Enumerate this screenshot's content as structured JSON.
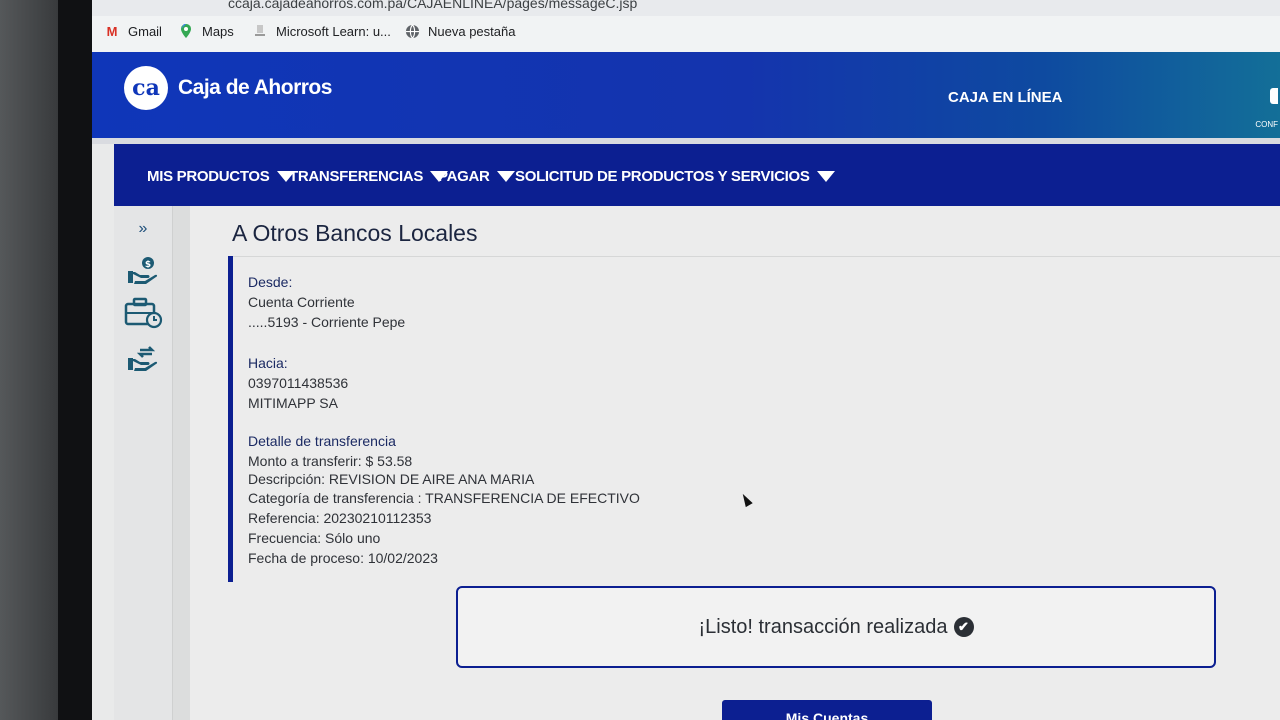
{
  "browser": {
    "url": "ccaja.cajadeahorros.com.pa/CAJAENLINEA/pages/messageC.jsp",
    "bookmarks": [
      {
        "label": "Gmail",
        "icon": "gmail-icon"
      },
      {
        "label": "Maps",
        "icon": "maps-icon"
      },
      {
        "label": "Microsoft Learn: u...",
        "icon": "microsoft-learn-icon"
      },
      {
        "label": "Nueva pestaña",
        "icon": "globe-icon"
      }
    ]
  },
  "header": {
    "logo_mark": "ca",
    "logo_text": "Caja de Ahorros",
    "online_label": "CAJA EN LÍNEA",
    "config_label": "CONF"
  },
  "nav": {
    "items": [
      {
        "label": "MIS PRODUCTOS"
      },
      {
        "label": "TRANSFERENCIAS"
      },
      {
        "label": "PAGAR"
      },
      {
        "label": "SOLICITUD DE PRODUCTOS Y SERVICIOS"
      }
    ]
  },
  "sidebar": {
    "collapse": "»",
    "icons": [
      "hand-money-icon",
      "briefcase-clock-icon",
      "hand-transfer-icon"
    ]
  },
  "page": {
    "title": "A Otros Bancos Locales"
  },
  "transfer": {
    "from_label": "Desde:",
    "from_type": "Cuenta Corriente",
    "from_account": ".....5193 - Corriente Pepe",
    "to_label": "Hacia:",
    "to_account": "0397011438536",
    "to_name": "MITIMAPP SA",
    "detail_label": "Detalle de transferencia",
    "amount": "Monto a transferir: $ 53.58",
    "description": "Descripción: REVISION DE AIRE ANA MARIA",
    "category": "Categoría de transferencia : TRANSFERENCIA DE EFECTIVO",
    "reference": "Referencia: 20230210112353",
    "frequency": "Frecuencia: Sólo uno",
    "process_date": "Fecha de proceso: 10/02/2023"
  },
  "status": {
    "message": "¡Listo! transacción realizada",
    "check": "✔"
  },
  "cta": {
    "label": "Mis Cuentas"
  },
  "colors": {
    "brand_blue": "#0f36b9",
    "nav_blue": "#0c1f91",
    "accent_teal": "#136f98"
  }
}
